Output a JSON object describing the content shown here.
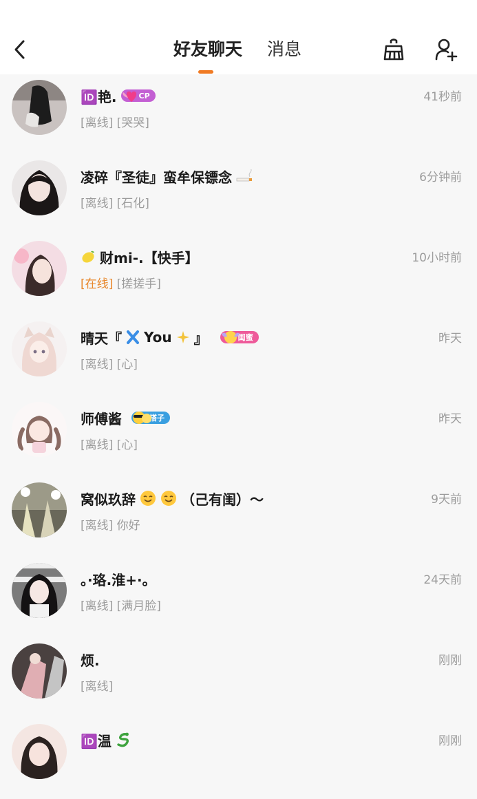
{
  "header": {
    "tabs": [
      {
        "label": "好友聊天",
        "active": true
      },
      {
        "label": "消息",
        "active": false
      }
    ],
    "accent_color": "#f07a23"
  },
  "chats": [
    {
      "name": "🆔艳.",
      "badge": "CP",
      "badge_color": "#c35fd3",
      "time": "41秒前",
      "status": "[离线]",
      "signature": "[哭哭]",
      "online": false
    },
    {
      "name": "凌碎『圣徒』蛮牟保镖念",
      "badge": "",
      "time": "6分钟前",
      "status": "[离线]",
      "signature": "[石化]",
      "online": false
    },
    {
      "name": "财mi-.【快手】",
      "badge": "",
      "time": "10小时前",
      "status": "[在线]",
      "signature": "[搓搓手]",
      "online": true
    },
    {
      "name": "晴天『",
      "name_suffix": "You",
      "name_end": "』",
      "badge": "闺蜜",
      "badge_color": "#ee5a9a",
      "time": "昨天",
      "status": "[离线]",
      "signature": "[心]",
      "online": false
    },
    {
      "name": "师傅酱",
      "badge": "搭子",
      "badge_color": "#3a9fe0",
      "time": "昨天",
      "status": "[离线]",
      "signature": "[心]",
      "online": false
    },
    {
      "name": "窝似玖辞",
      "name_end": "（己有闺）～",
      "badge": "",
      "time": "9天前",
      "status": "[离线]",
      "signature": "你好",
      "online": false
    },
    {
      "name": "。·珞.淮+·。",
      "badge": "",
      "time": "24天前",
      "status": "[离线]",
      "signature": "[满月脸]",
      "online": false
    },
    {
      "name": "烦.",
      "badge": "",
      "time": "刚刚",
      "status": "[离线]",
      "signature": "",
      "online": false
    },
    {
      "name": "🆔温",
      "badge": "",
      "time": "刚刚",
      "status": "",
      "signature": "",
      "online": false
    }
  ]
}
